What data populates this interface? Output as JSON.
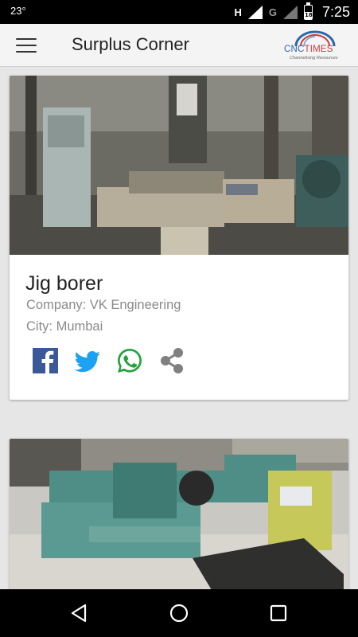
{
  "status_bar": {
    "temperature": "23°",
    "network_h": "H",
    "network_g": "G",
    "battery_level": "18",
    "time": "7:25"
  },
  "app_bar": {
    "title": "Surplus Corner",
    "logo": {
      "brand_cnc": "CNC",
      "brand_times": "TIMES",
      "tagline": "Channelising Resources"
    }
  },
  "listings": [
    {
      "title": "Jig borer",
      "company": "Company: VK Engineering",
      "city": "City: Mumbai",
      "share": [
        "facebook-icon",
        "twitter-icon",
        "whatsapp-icon",
        "share-icon"
      ]
    },
    {
      "title": "",
      "company": "",
      "city": ""
    }
  ],
  "nav": [
    "back-icon",
    "home-icon",
    "recents-icon"
  ],
  "colors": {
    "facebook": "#3b5998",
    "twitter": "#1da1f2",
    "whatsapp": "#25a33b",
    "share": "#808080",
    "logo_blue": "#2b6aa8",
    "logo_red": "#c73a3e"
  }
}
